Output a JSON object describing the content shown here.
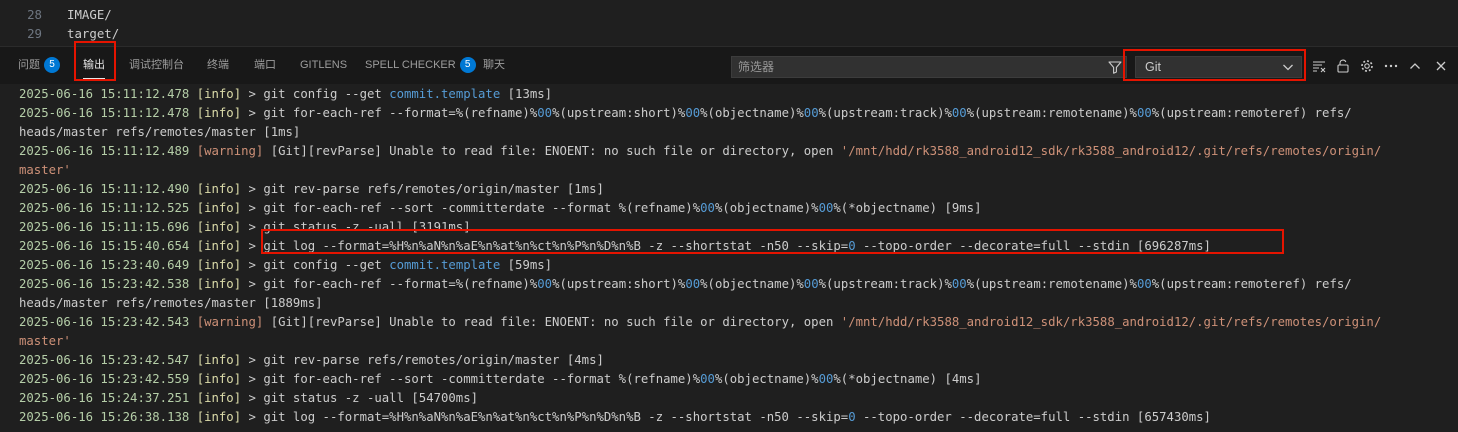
{
  "editor": {
    "lines": [
      {
        "num": "28",
        "text": "IMAGE/"
      },
      {
        "num": "29",
        "text": "target/"
      }
    ]
  },
  "panel": {
    "tabs": [
      {
        "label": "问题",
        "badge": "5"
      },
      {
        "label": "输出"
      },
      {
        "label": "调试控制台"
      },
      {
        "label": "终端"
      },
      {
        "label": "端口"
      },
      {
        "label": "GITLENS"
      },
      {
        "label": "SPELL CHECKER",
        "badge": "5"
      },
      {
        "label": "聊天"
      }
    ],
    "active_tab": "输出",
    "filter_placeholder": "筛选器",
    "channel": "Git",
    "accent": "#0078d4",
    "highlight": "#e51400"
  },
  "output": {
    "lines": [
      {
        "segs": [
          {
            "t": "2025-06-16 15:11:12.478 ",
            "c": "ts"
          },
          {
            "t": "[info]",
            "c": "lv"
          },
          {
            "t": " > git config --get ",
            "c": "tx"
          },
          {
            "t": "commit.template",
            "c": "kw"
          },
          {
            "t": " [13ms]",
            "c": "tx"
          }
        ]
      },
      {
        "segs": [
          {
            "t": "2025-06-16 15:11:12.478 ",
            "c": "ts"
          },
          {
            "t": "[info]",
            "c": "lv"
          },
          {
            "t": " > git for-each-ref --format=%(refname)%",
            "c": "tx"
          },
          {
            "t": "00",
            "c": "kw"
          },
          {
            "t": "%(upstream:short)%",
            "c": "tx"
          },
          {
            "t": "00",
            "c": "kw"
          },
          {
            "t": "%(objectname)%",
            "c": "tx"
          },
          {
            "t": "00",
            "c": "kw"
          },
          {
            "t": "%(upstream:track)%",
            "c": "tx"
          },
          {
            "t": "00",
            "c": "kw"
          },
          {
            "t": "%(upstream:remotename)%",
            "c": "tx"
          },
          {
            "t": "00",
            "c": "kw"
          },
          {
            "t": "%(upstream:remoteref) refs/",
            "c": "tx"
          }
        ]
      },
      {
        "segs": [
          {
            "t": "heads/master refs/remotes/master [1ms]",
            "c": "tx"
          }
        ]
      },
      {
        "segs": [
          {
            "t": "2025-06-16 15:11:12.489 ",
            "c": "ts"
          },
          {
            "t": "[warning]",
            "c": "warn"
          },
          {
            "t": " [Git][revParse] Unable to read file: ENOENT: no such file or directory, open ",
            "c": "tx"
          },
          {
            "t": "'/mnt/hdd/rk3588_android12_sdk/rk3588_android12/.git/refs/remotes/origin/",
            "c": "path"
          }
        ]
      },
      {
        "segs": [
          {
            "t": "master'",
            "c": "path"
          }
        ]
      },
      {
        "segs": [
          {
            "t": "2025-06-16 15:11:12.490 ",
            "c": "ts"
          },
          {
            "t": "[info]",
            "c": "lv"
          },
          {
            "t": " > git rev-parse refs/remotes/origin/master [1ms]",
            "c": "tx"
          }
        ]
      },
      {
        "segs": [
          {
            "t": "2025-06-16 15:11:12.525 ",
            "c": "ts"
          },
          {
            "t": "[info]",
            "c": "lv"
          },
          {
            "t": " > git for-each-ref --sort -committerdate --format %(refname)%",
            "c": "tx"
          },
          {
            "t": "00",
            "c": "kw"
          },
          {
            "t": "%(objectname)%",
            "c": "tx"
          },
          {
            "t": "00",
            "c": "kw"
          },
          {
            "t": "%(*objectname) [9ms]",
            "c": "tx"
          }
        ]
      },
      {
        "segs": [
          {
            "t": "2025-06-16 15:11:15.696 ",
            "c": "ts"
          },
          {
            "t": "[info]",
            "c": "lv"
          },
          {
            "t": " > git status -z -uall [3191ms]",
            "c": "tx"
          }
        ]
      },
      {
        "segs": [
          {
            "t": "2025-06-16 15:15:40.654 ",
            "c": "ts"
          },
          {
            "t": "[info]",
            "c": "lv"
          },
          {
            "t": " > git log --format=%H%n%aN%n%aE%n%at%n%ct%n%P%n%D%n%B -z --shortstat -n50 --skip=",
            "c": "tx"
          },
          {
            "t": "0",
            "c": "kw"
          },
          {
            "t": " --topo-order --decorate=full --stdin [696287ms]",
            "c": "tx"
          }
        ]
      },
      {
        "segs": [
          {
            "t": "2025-06-16 15:23:40.649 ",
            "c": "ts"
          },
          {
            "t": "[info]",
            "c": "lv"
          },
          {
            "t": " > git config --get ",
            "c": "tx"
          },
          {
            "t": "commit.template",
            "c": "kw"
          },
          {
            "t": " [59ms]",
            "c": "tx"
          }
        ]
      },
      {
        "segs": [
          {
            "t": "2025-06-16 15:23:42.538 ",
            "c": "ts"
          },
          {
            "t": "[info]",
            "c": "lv"
          },
          {
            "t": " > git for-each-ref --format=%(refname)%",
            "c": "tx"
          },
          {
            "t": "00",
            "c": "kw"
          },
          {
            "t": "%(upstream:short)%",
            "c": "tx"
          },
          {
            "t": "00",
            "c": "kw"
          },
          {
            "t": "%(objectname)%",
            "c": "tx"
          },
          {
            "t": "00",
            "c": "kw"
          },
          {
            "t": "%(upstream:track)%",
            "c": "tx"
          },
          {
            "t": "00",
            "c": "kw"
          },
          {
            "t": "%(upstream:remotename)%",
            "c": "tx"
          },
          {
            "t": "00",
            "c": "kw"
          },
          {
            "t": "%(upstream:remoteref) refs/",
            "c": "tx"
          }
        ]
      },
      {
        "segs": [
          {
            "t": "heads/master refs/remotes/master [1889ms]",
            "c": "tx"
          }
        ]
      },
      {
        "segs": [
          {
            "t": "2025-06-16 15:23:42.543 ",
            "c": "ts"
          },
          {
            "t": "[warning]",
            "c": "warn"
          },
          {
            "t": " [Git][revParse] Unable to read file: ENOENT: no such file or directory, open ",
            "c": "tx"
          },
          {
            "t": "'/mnt/hdd/rk3588_android12_sdk/rk3588_android12/.git/refs/remotes/origin/",
            "c": "path"
          }
        ]
      },
      {
        "segs": [
          {
            "t": "master'",
            "c": "path"
          }
        ]
      },
      {
        "segs": [
          {
            "t": "2025-06-16 15:23:42.547 ",
            "c": "ts"
          },
          {
            "t": "[info]",
            "c": "lv"
          },
          {
            "t": " > git rev-parse refs/remotes/origin/master [4ms]",
            "c": "tx"
          }
        ]
      },
      {
        "segs": [
          {
            "t": "2025-06-16 15:23:42.559 ",
            "c": "ts"
          },
          {
            "t": "[info]",
            "c": "lv"
          },
          {
            "t": " > git for-each-ref --sort -committerdate --format %(refname)%",
            "c": "tx"
          },
          {
            "t": "00",
            "c": "kw"
          },
          {
            "t": "%(objectname)%",
            "c": "tx"
          },
          {
            "t": "00",
            "c": "kw"
          },
          {
            "t": "%(*objectname) [4ms]",
            "c": "tx"
          }
        ]
      },
      {
        "segs": [
          {
            "t": "2025-06-16 15:24:37.251 ",
            "c": "ts"
          },
          {
            "t": "[info]",
            "c": "lv"
          },
          {
            "t": " > git status -z -uall [54700ms]",
            "c": "tx"
          }
        ]
      },
      {
        "segs": [
          {
            "t": "2025-06-16 15:26:38.138 ",
            "c": "ts"
          },
          {
            "t": "[info]",
            "c": "lv"
          },
          {
            "t": " > git log --format=%H%n%aN%n%aE%n%at%n%ct%n%P%n%D%n%B -z --shortstat -n50 --skip=",
            "c": "tx"
          },
          {
            "t": "0",
            "c": "kw"
          },
          {
            "t": " --topo-order --decorate=full --stdin [657430ms]",
            "c": "tx"
          }
        ]
      }
    ]
  }
}
